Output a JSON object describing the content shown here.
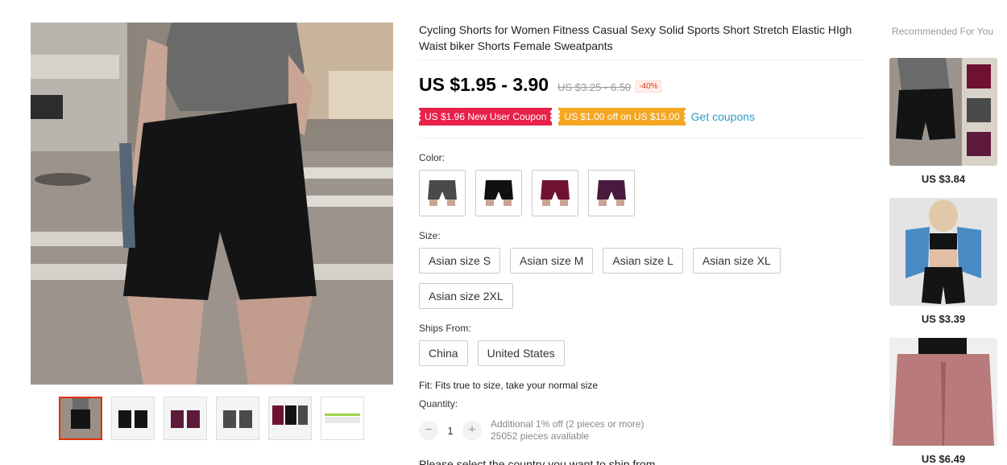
{
  "product": {
    "title": "Cycling Shorts for Women Fitness Casual Sexy Solid Sports Short Stretch Elastic HIgh Waist biker Shorts Female Sweatpants",
    "price": "US $1.95 - 3.90",
    "original_price": "US $3.25 - 6.50",
    "discount": "-40%",
    "coupons": {
      "new_user": "US $1.96 New User Coupon",
      "store": "US $1.00 off on US $15.00",
      "get_link": "Get coupons"
    },
    "color_label": "Color:",
    "colors": [
      "dark-gray",
      "black",
      "burgundy",
      "plum"
    ],
    "color_hex": [
      "#4a4a4a",
      "#111111",
      "#6e1230",
      "#4a1a3e"
    ],
    "size_label": "Size:",
    "sizes": [
      "Asian size S",
      "Asian size M",
      "Asian size L",
      "Asian size XL",
      "Asian size 2XL"
    ],
    "ships_label": "Ships From:",
    "ships_from": [
      "China",
      "United States"
    ],
    "fit": "Fit: Fits true to size, take your normal size",
    "quantity_label": "Quantity:",
    "quantity": {
      "minus": "−",
      "value": "1",
      "plus": "+",
      "note1": "Additional 1% off (2 pieces or more)",
      "note2": "25052 pieces available"
    },
    "cut_off_text": "Please select the country you want to ship from"
  },
  "recommended": {
    "title": "Recommended For You",
    "items": [
      {
        "price": "US $3.84"
      },
      {
        "price": "US $3.39"
      },
      {
        "price": "US $6.49"
      }
    ]
  },
  "colors": {
    "accent_red": "#e8204a",
    "accent_orange": "#f5a623",
    "link_blue": "#2e9cc3"
  }
}
